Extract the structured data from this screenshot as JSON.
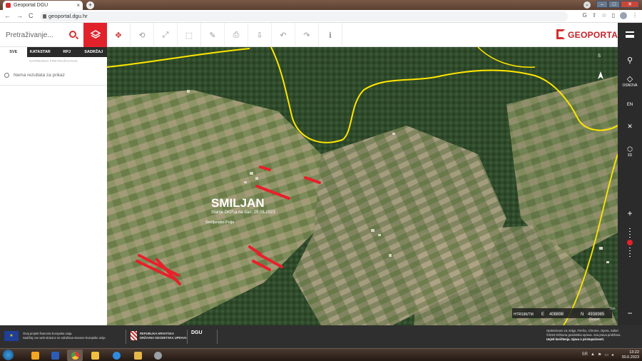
{
  "browser": {
    "tab_title": "Geoportal DGU",
    "tab_close": "×",
    "new_tab": "+",
    "url": "geoportal.dgu.hr",
    "nav": {
      "back": "←",
      "forward": "→",
      "reload": "C"
    },
    "right_icons": [
      "G",
      "⇪",
      "☆",
      "▯",
      "⋮"
    ],
    "window_buttons": {
      "min": "–",
      "max": "□",
      "close": "✕"
    }
  },
  "app": {
    "search_placeholder": "Pretraživanje...",
    "logo_text": "GEOPORTAL",
    "toolbar_icons": [
      "layers-icon",
      "move-icon",
      "rotate-icon",
      "fullscreen-icon",
      "measure-area-icon",
      "draw-icon",
      "print-icon",
      "share-icon",
      "undo-icon",
      "redo-icon",
      "info-icon"
    ],
    "toolbar_glyphs": [
      "✥",
      "⟲",
      "⤢",
      "⬚",
      "✎",
      "⎙",
      "⇩",
      "↶",
      "↷",
      "ℹ"
    ]
  },
  "left_panel": {
    "tabs": [
      "SVE",
      "KATASTAR",
      "RPJ",
      "SADRŽAJ"
    ],
    "active_tab": "SVE",
    "advanced_search": "NAPREDNO PRETRAŽIVANJE",
    "results_text": "Nema rezultata za prikaz"
  },
  "map": {
    "place_name": "SMILJAN",
    "status_text": "Stanje DKP-a na dan: 29.06.2023",
    "sub_place": "Smiljansko Polje",
    "north_label": "S",
    "coord_system": "HTRS96/TM",
    "e_label": "E",
    "e_value": "408898",
    "n_label": "N",
    "n_value": "4938985",
    "cursor_text": "Gospic",
    "partial_right": "Sm",
    "road_color": "#ffe600",
    "parcel_color": "#e8202a"
  },
  "right_bar": {
    "basemap_label": "OSNOVA",
    "lang_label": "EN",
    "three_d_label": "3D",
    "zoom_in": "+",
    "zoom_out": "−"
  },
  "footer": {
    "eu_line1": "Ovaj projekt financira Europska unija.",
    "eu_line2": "Sadržaj ove web stranice ne odražava stavove Europske unije.",
    "hr_line1": "REPUBLIKA HRVATSKA",
    "hr_line2": "DRŽAVNA GEODETSKA UPRAVA",
    "dgu_logo": "DGU",
    "right_line1": "Optimizirano za: Edge, Firefox, Chrome, Opera, Safari",
    "right_line2": "©2023 Državna geodetska uprava. Sva prava pridržana",
    "right_line3": "Uvjeti korištenja. Izjava o pristupačnosti."
  },
  "taskbar": {
    "lang": "SR",
    "time": "13:22",
    "date": "30.6.2023"
  }
}
